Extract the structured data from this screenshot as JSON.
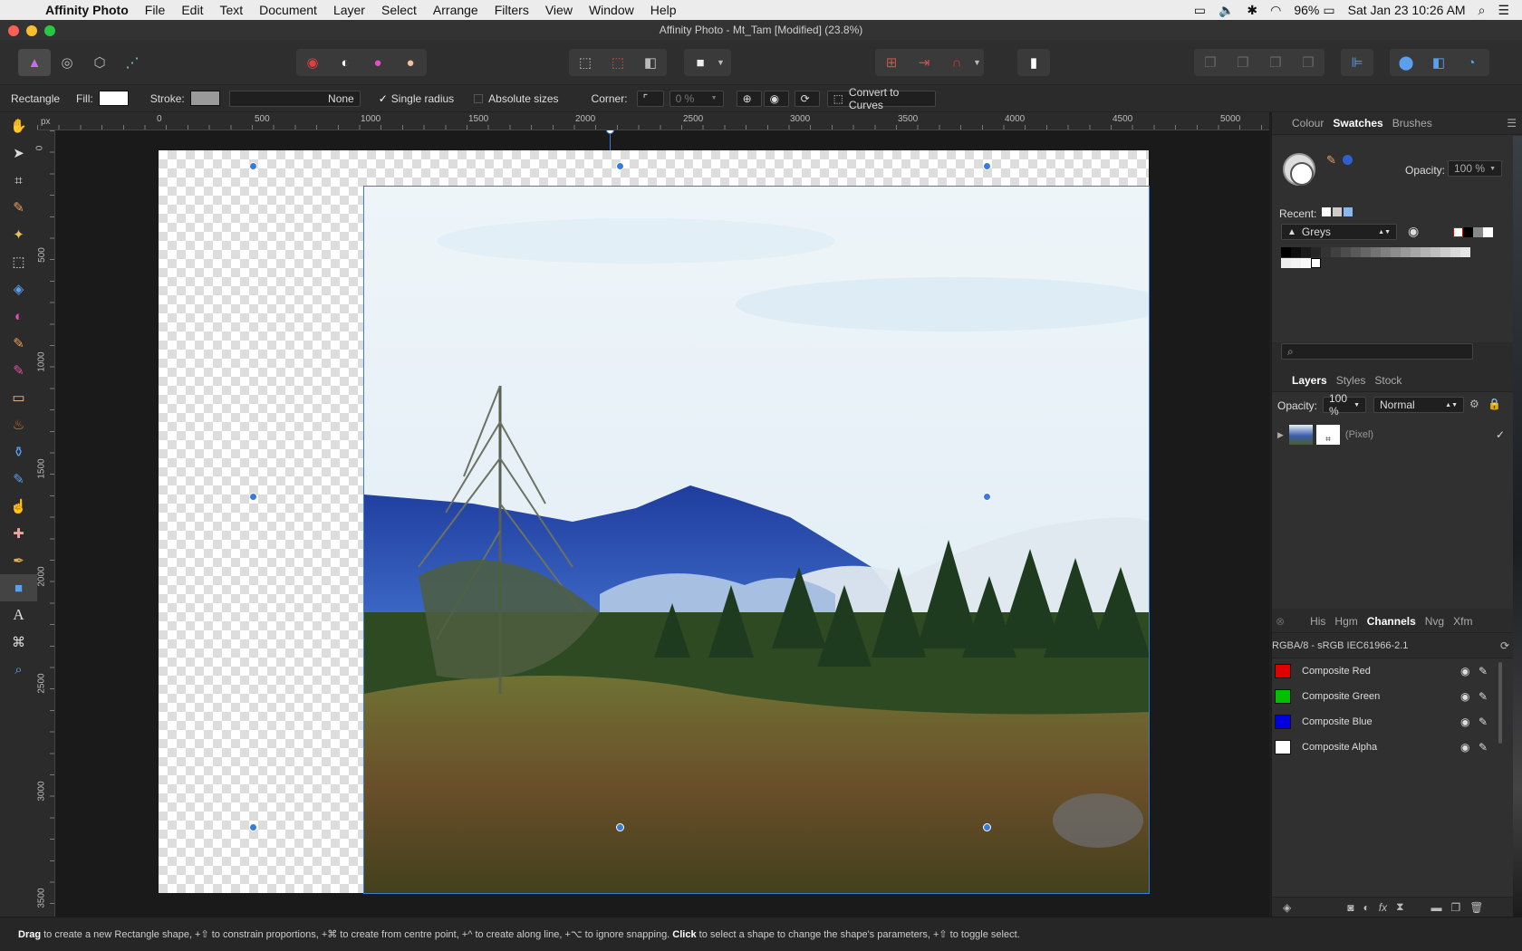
{
  "menubar": {
    "app_name": "Affinity Photo",
    "items": [
      "File",
      "Edit",
      "Text",
      "Document",
      "Layer",
      "Select",
      "Arrange",
      "Filters",
      "View",
      "Window",
      "Help"
    ],
    "battery": "96%",
    "datetime": "Sat Jan 23  10:26 AM"
  },
  "window": {
    "title": "Affinity Photo - Mt_Tam [Modified] (23.8%)"
  },
  "context": {
    "tool_name": "Rectangle",
    "fill_label": "Fill:",
    "stroke_label": "Stroke:",
    "stroke_value": "None",
    "single_radius_label": "Single radius",
    "absolute_sizes_label": "Absolute sizes",
    "corner_label": "Corner:",
    "corner_value": "0 %",
    "convert_label": "Convert to Curves"
  },
  "ruler": {
    "unit": "px",
    "top_ticks": [
      "0",
      "500",
      "1000",
      "1500",
      "2000",
      "2500",
      "3000",
      "3500",
      "4000",
      "4500",
      "5000"
    ],
    "left_ticks": [
      "0",
      "500",
      "1000",
      "1500",
      "2000",
      "2500",
      "3000",
      "3500"
    ]
  },
  "swatches_panel": {
    "tabs": [
      "Colour",
      "Swatches",
      "Brushes"
    ],
    "active_tab": "Swatches",
    "opacity_label": "Opacity:",
    "opacity_value": "100 %",
    "recent_label": "Recent:",
    "palette_name": "Greys"
  },
  "layers_panel": {
    "tabs": [
      "Layers",
      "Styles",
      "Stock"
    ],
    "active_tab": "Layers",
    "opacity_label": "Opacity:",
    "opacity_value": "100 %",
    "blend_mode": "Normal",
    "layer_name": "(Pixel)"
  },
  "channels_panel": {
    "tabs": [
      "His",
      "Hgm",
      "Channels",
      "Nvg",
      "Xfm"
    ],
    "active_tab": "Channels",
    "profile": "RGBA/8 - sRGB IEC61966-2.1",
    "channels": [
      {
        "name": "Composite Red",
        "color": "#e00000"
      },
      {
        "name": "Composite Green",
        "color": "#00c000"
      },
      {
        "name": "Composite Blue",
        "color": "#0000e0"
      },
      {
        "name": "Composite Alpha",
        "color": "#ffffff"
      }
    ]
  },
  "status": {
    "w1": "Drag",
    "t1": " to create a new Rectangle shape, +⇧ to constrain proportions, +⌘ to create from centre point, +^ to create along line, +⌥ to ignore snapping. ",
    "w2": "Click",
    "t2": " to select a shape to change the shape's parameters, +⇧ to toggle select."
  }
}
